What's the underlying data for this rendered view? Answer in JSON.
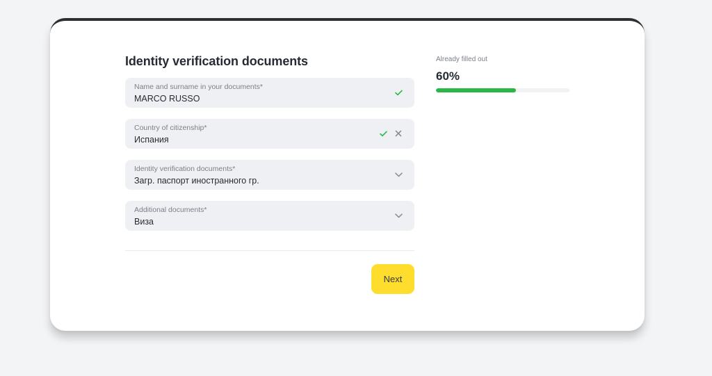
{
  "form": {
    "title": "Identity verification documents",
    "fields": [
      {
        "label": "Name and surname in your documents*",
        "value": "MARCO RUSSO",
        "icons": [
          "check-icon"
        ]
      },
      {
        "label": "Country of citizenship*",
        "value": "Испания",
        "icons": [
          "check-icon",
          "clear-icon"
        ]
      },
      {
        "label": "Identity verification documents*",
        "value": "Загр. паспорт иностранного гр.",
        "icons": [
          "chevron-down-icon"
        ]
      },
      {
        "label": "Additional documents*",
        "value": "Виза",
        "icons": [
          "chevron-down-icon"
        ]
      }
    ],
    "next_label": "Next"
  },
  "progress": {
    "label": "Already filled out",
    "value_text": "60%",
    "fraction": 0.6
  },
  "colors": {
    "accent": "#ffdd2d",
    "success": "#29b845",
    "field_bg": "#eff0f3",
    "text": "#262b33"
  }
}
